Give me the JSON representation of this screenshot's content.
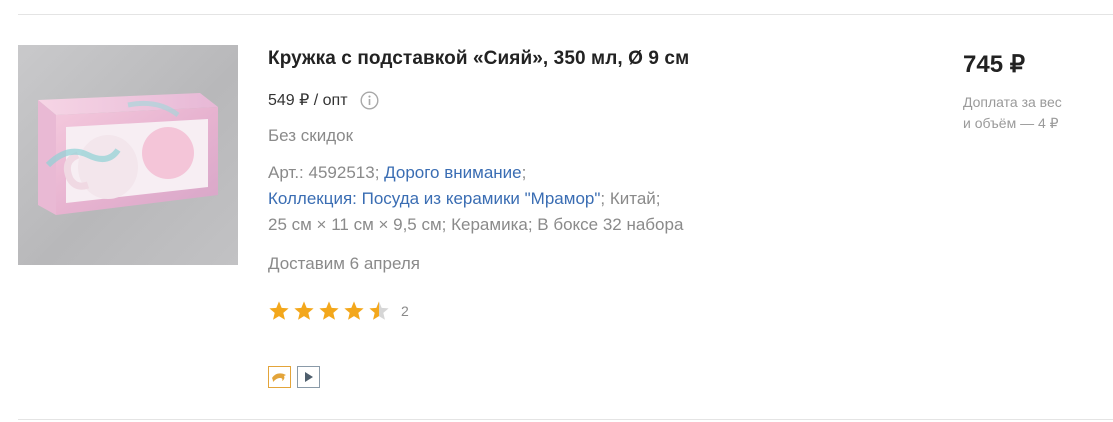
{
  "product": {
    "title": "Кружка с подставкой «Сияй», 350 мл, Ø 9 см",
    "wholesale_price": "549 ₽ / опт",
    "discount_note": "Без скидок",
    "article_label": "Арт.:",
    "article_value": "4592513;",
    "brand_link": "Дорого внимание",
    "collection_link": "Коллекция: Посуда из керамики \"Мрамор\"",
    "country": "; Китай;",
    "specs": "25 см × 11 см × 9,5 см; Керамика; В боксе 32 набора",
    "delivery": "Доставим 6 апреля",
    "rating": 4.5,
    "rating_max": 5,
    "reviews_count": "2",
    "price": "745 ₽",
    "surcharge_line1": "Доплата за вес",
    "surcharge_line2": "и объём — 4 ₽"
  },
  "icons": {
    "info": "info-icon",
    "badge_1": "dolphin-icon",
    "badge_2": "play-icon",
    "star": "star-icon"
  },
  "colors": {
    "link": "#3a6db3",
    "star": "#f3a71b",
    "muted": "#8a8a8a",
    "badge_dolphin": "#e3a43a"
  }
}
